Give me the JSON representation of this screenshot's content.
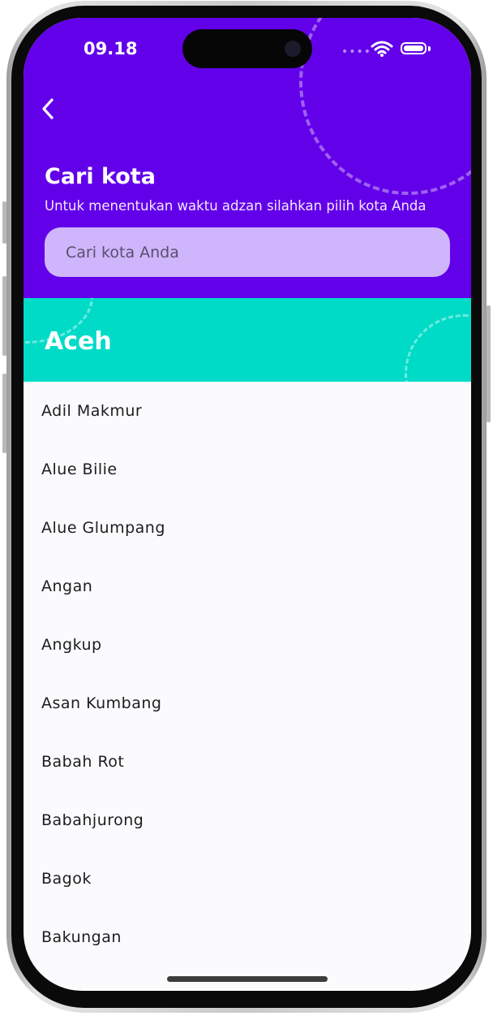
{
  "status_bar": {
    "time": "09.18"
  },
  "header": {
    "title": "Cari kota",
    "subtitle": "Untuk menentukan waktu adzan silahkan pilih kota Anda",
    "search_placeholder": "Cari kota Anda",
    "background_color": "#6300EA"
  },
  "province": {
    "name": "Aceh",
    "background_color": "#00DBC8"
  },
  "cities": [
    "Adil Makmur",
    "Alue Bilie",
    "Alue Glumpang",
    "Angan",
    "Angkup",
    "Asan Kumbang",
    "Babah Rot",
    "Babahjurong",
    "Bagok",
    "Bakungan"
  ],
  "icons": {
    "back": "chevron-left-icon",
    "wifi": "wifi-icon",
    "battery": "battery-icon"
  }
}
